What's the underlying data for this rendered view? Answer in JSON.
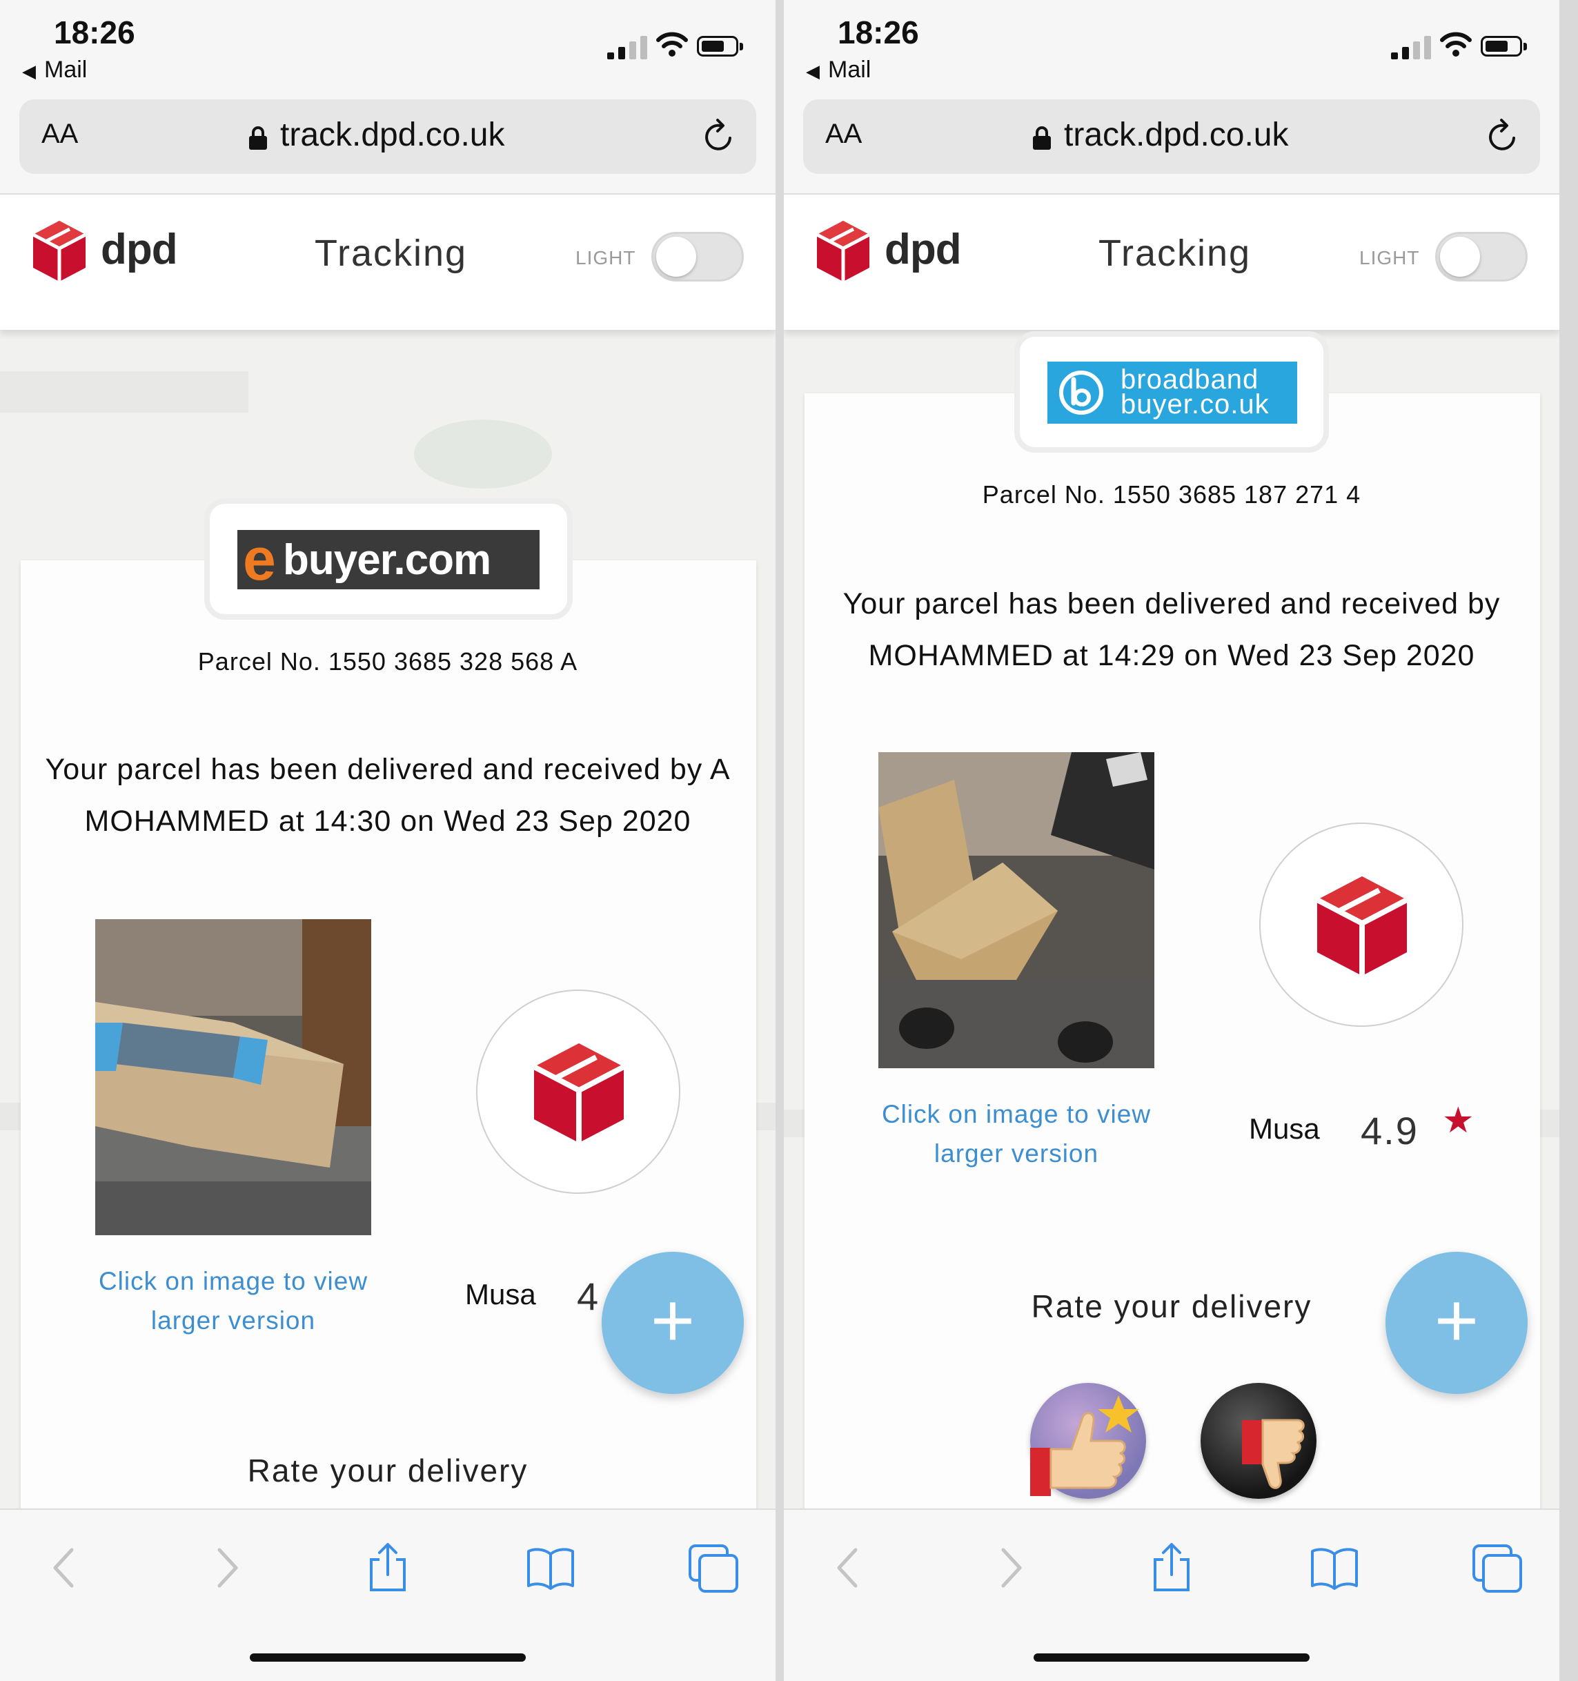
{
  "screens": [
    {
      "status": {
        "time": "18:26",
        "back_label": "Mail"
      },
      "browser": {
        "text_size": "AA",
        "url": "track.dpd.co.uk"
      },
      "header": {
        "logo_text": "dpd",
        "title": "Tracking",
        "theme_label": "LIGHT"
      },
      "retailer": "ebuyer.com",
      "parcel_number": "Parcel No. 1550 3685 328 568 A",
      "delivery_message": "Your parcel has been delivered and received by A MOHAMMED at 14:30 on Wed 23 Sep 2020",
      "photo_hint": "Click on image to view larger version",
      "driver": {
        "name": "Musa",
        "rating": "4"
      },
      "rate_heading": "Rate your delivery",
      "fab_label": "+"
    },
    {
      "status": {
        "time": "18:26",
        "back_label": "Mail"
      },
      "browser": {
        "text_size": "AA",
        "url": "track.dpd.co.uk"
      },
      "header": {
        "logo_text": "dpd",
        "title": "Tracking",
        "theme_label": "LIGHT"
      },
      "retailer": {
        "line1": "broadband",
        "line2": "buyer.co.uk"
      },
      "parcel_number": "Parcel No. 1550 3685 187 271 4",
      "delivery_message": "Your parcel has been delivered and received by MOHAMMED at 14:29 on Wed 23 Sep 2020",
      "photo_hint": "Click on image to view larger version",
      "driver": {
        "name": "Musa",
        "rating": "4.9",
        "star": "★"
      },
      "rate_heading": "Rate your delivery",
      "fab_label": "+"
    }
  ],
  "colors": {
    "dpd_red": "#c8102e",
    "link_blue": "#3d8ed1",
    "fab_blue": "#7fbfe5",
    "ebuyer_orange": "#ee7a21",
    "bbb_blue": "#29a6de"
  },
  "icons": [
    "signal-icon",
    "wifi-icon",
    "battery-icon",
    "lock-icon",
    "reload-icon",
    "dpd-cube-icon",
    "back-arrow-icon",
    "forward-arrow-icon",
    "share-icon",
    "bookmarks-icon",
    "tabs-icon",
    "thumbs-up-icon",
    "thumbs-down-icon"
  ]
}
